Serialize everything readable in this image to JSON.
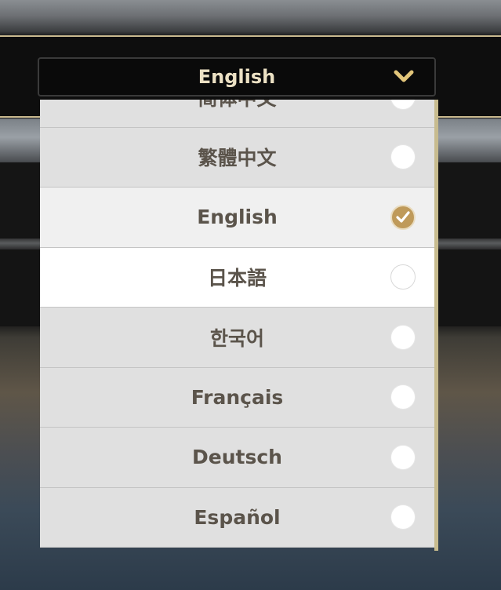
{
  "dropdown": {
    "selected_label": "English",
    "icon": "chevron-down-icon",
    "options": [
      {
        "label": "简体中文",
        "checked": false
      },
      {
        "label": "繁體中文",
        "checked": false
      },
      {
        "label": "English",
        "checked": true
      },
      {
        "label": "日本語",
        "checked": false
      },
      {
        "label": "한국어",
        "checked": false
      },
      {
        "label": "Français",
        "checked": false
      },
      {
        "label": "Deutsch",
        "checked": false
      },
      {
        "label": "Español",
        "checked": false
      }
    ]
  },
  "colors": {
    "accent_gold": "#c9b98f",
    "check_fill": "#bf9a5a",
    "item_text": "#5b544b",
    "header_text": "#ece1c4"
  }
}
